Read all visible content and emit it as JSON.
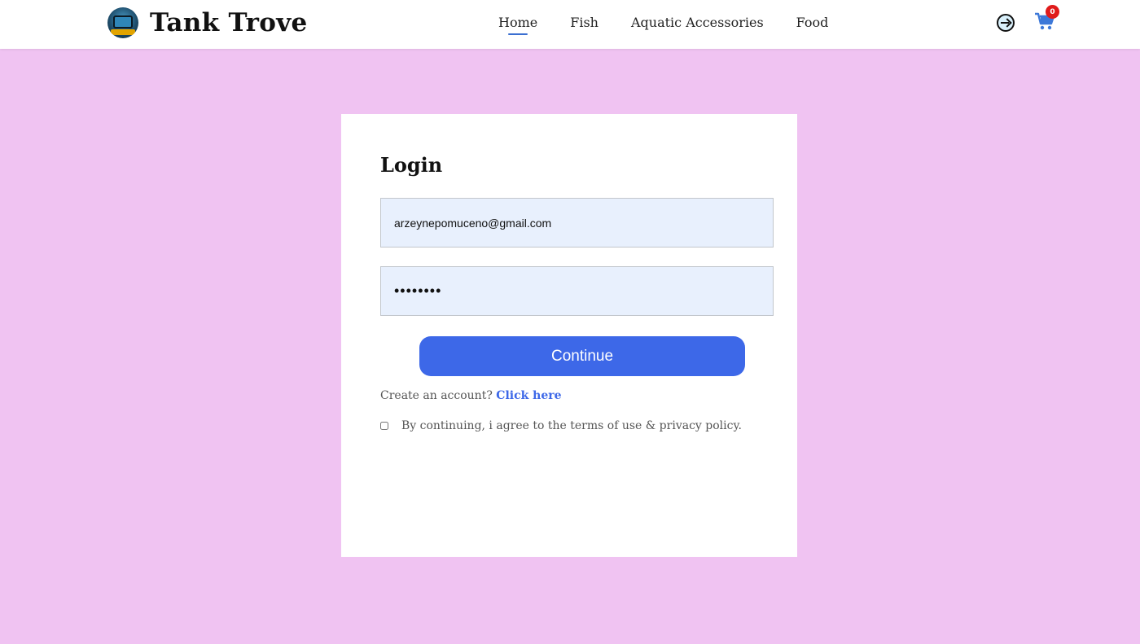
{
  "brand": {
    "name": "Tank Trove",
    "logo_text": "TANK TROVE"
  },
  "nav": {
    "links": [
      {
        "label": "Home",
        "active": true
      },
      {
        "label": "Fish",
        "active": false
      },
      {
        "label": "Aquatic Accessories",
        "active": false
      },
      {
        "label": "Food",
        "active": false
      }
    ],
    "login_icon": "login-arrow-icon",
    "cart_icon": "shopping-cart-icon",
    "cart_count": "0"
  },
  "login": {
    "title": "Login",
    "email_value": "arzeynepomuceno@gmail.com",
    "password_value": "••••••••",
    "continue_label": "Continue",
    "signup_prompt": "Create an account?",
    "signup_link": "Click here",
    "agree_text": "By continuing, i agree to the terms of use & privacy policy.",
    "agree_checked": false
  },
  "colors": {
    "page_background": "#f0c3f2",
    "accent": "#3d68e8",
    "input_background": "#e8f0fd",
    "badge": "#e01b1b"
  }
}
